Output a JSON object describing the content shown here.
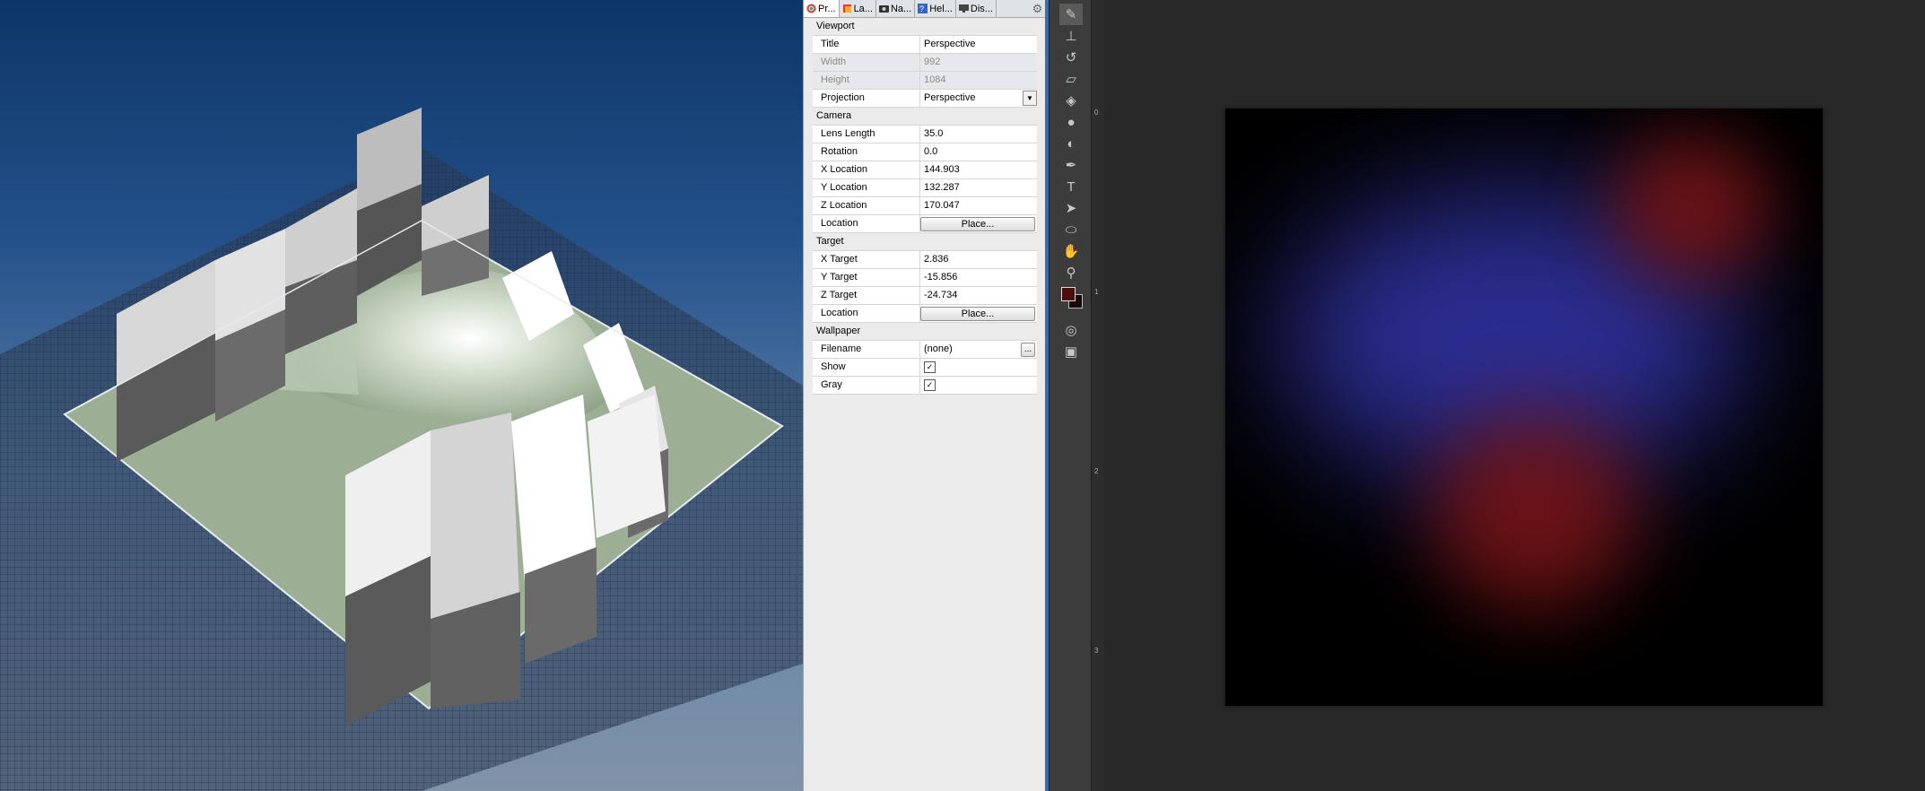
{
  "props_panel": {
    "tabs": [
      {
        "label": "Pr...",
        "icon": "properties-icon"
      },
      {
        "label": "La...",
        "icon": "layers-icon"
      },
      {
        "label": "Na...",
        "icon": "named-views-icon"
      },
      {
        "label": "Hel...",
        "icon": "help-icon"
      },
      {
        "label": "Dis...",
        "icon": "display-icon"
      }
    ],
    "viewport": {
      "heading": "Viewport",
      "title_label": "Title",
      "title_value": "Perspective",
      "width_label": "Width",
      "width_value": "992",
      "height_label": "Height",
      "height_value": "1084",
      "projection_label": "Projection",
      "projection_value": "Perspective"
    },
    "camera": {
      "heading": "Camera",
      "lens_label": "Lens Length",
      "lens_value": "35.0",
      "rotation_label": "Rotation",
      "rotation_value": "0.0",
      "x_label": "X Location",
      "x_value": "144.903",
      "y_label": "Y Location",
      "y_value": "132.287",
      "z_label": "Z Location",
      "z_value": "170.047",
      "location_label": "Location",
      "place_button": "Place..."
    },
    "target": {
      "heading": "Target",
      "x_label": "X Target",
      "x_value": "2.836",
      "y_label": "Y Target",
      "y_value": "-15.856",
      "z_label": "Z Target",
      "z_value": "-24.734",
      "location_label": "Location",
      "place_button": "Place..."
    },
    "wallpaper": {
      "heading": "Wallpaper",
      "filename_label": "Filename",
      "filename_value": "(none)",
      "browse_button": "...",
      "show_label": "Show",
      "show_checked": true,
      "gray_label": "Gray",
      "gray_checked": true
    }
  },
  "toolbar": {
    "tools": [
      "brush-icon",
      "stamp-icon",
      "history-brush-icon",
      "eraser-icon",
      "bucket-icon",
      "blur-icon",
      "dodge-icon",
      "pen-icon",
      "type-icon",
      "path-select-icon",
      "ellipse-icon",
      "hand-icon",
      "zoom-icon"
    ],
    "type_tool_label": "T",
    "foreground_color": "#4a0f0f",
    "background_color": "#1a0808"
  },
  "ruler": {
    "marks": [
      "0",
      "1",
      "2",
      "3"
    ]
  },
  "colors": {
    "viewport_top": "#0d3667",
    "viewport_bottom": "#8093a8",
    "ground": "#9caf95",
    "canvas_bg": "#000000",
    "blue_blob": "#3a3cc0",
    "red_blob": "#7a1414"
  }
}
